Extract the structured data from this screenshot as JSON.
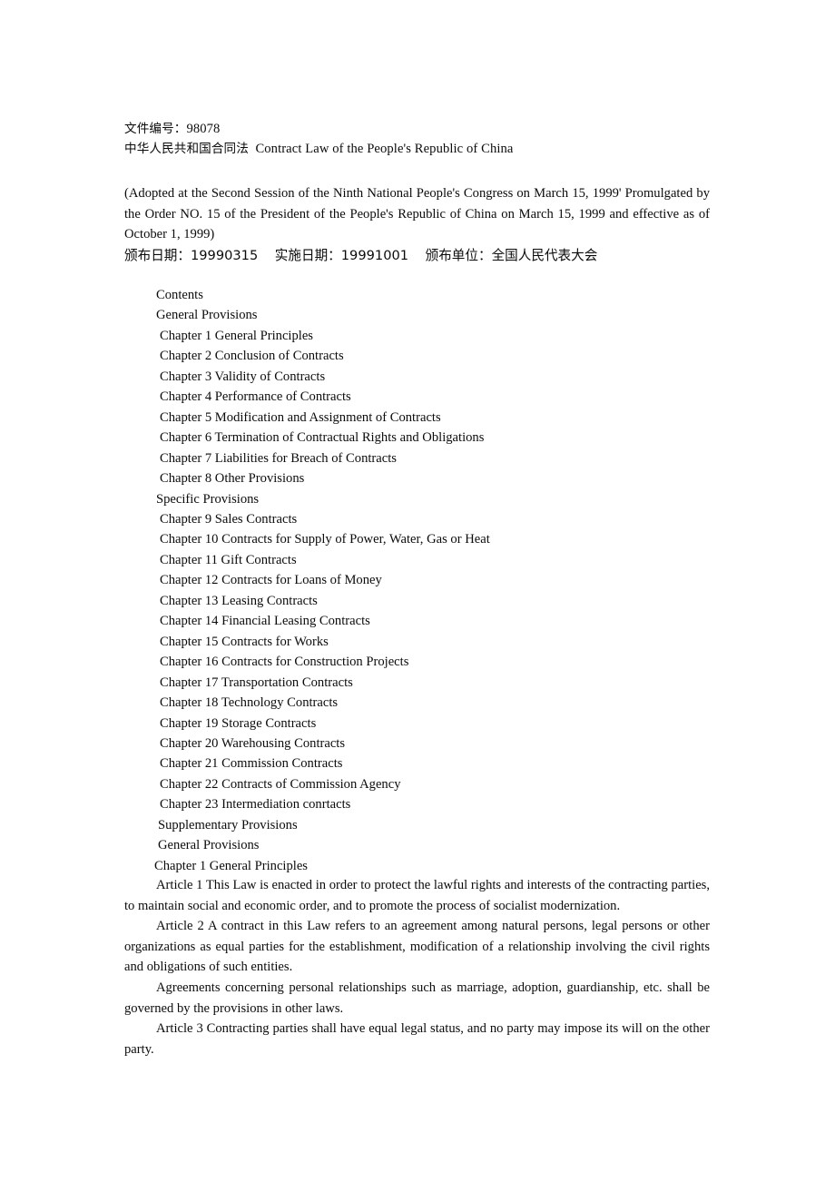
{
  "document": {
    "file_number_label": "文件编号：",
    "file_number_value": "98078",
    "title_cn": "中华人民共和国合同法",
    "title_en": "Contract Law of the People's Republic of China"
  },
  "adoption": {
    "note": "(Adopted at the Second Session of the Ninth National People's Congress on March 15, 1999' Promulgated by the Order NO. 15 of the President of the People's Republic of China on March 15, 1999 and effective as of October 1, 1999)",
    "dates_line": "颁布日期：19990315    实施日期：19991001    颁布单位：全国人民代表大会"
  },
  "contents": {
    "items": [
      {
        "label": "Contents",
        "level": 0
      },
      {
        "label": "General Provisions",
        "level": 0
      },
      {
        "label": "Chapter 1 General Principles",
        "level": 1
      },
      {
        "label": "Chapter 2 Conclusion of Contracts",
        "level": 1
      },
      {
        "label": "Chapter 3 Validity of Contracts",
        "level": 1
      },
      {
        "label": "Chapter 4 Performance of Contracts",
        "level": 1
      },
      {
        "label": "Chapter 5 Modification and Assignment of Contracts",
        "level": 1
      },
      {
        "label": "Chapter 6 Termination of Contractual Rights and Obligations",
        "level": 1
      },
      {
        "label": "Chapter 7 Liabilities for Breach of Contracts",
        "level": 1
      },
      {
        "label": "Chapter 8 Other Provisions",
        "level": 1
      },
      {
        "label": "Specific Provisions",
        "level": 0
      },
      {
        "label": "Chapter 9 Sales Contracts",
        "level": 1
      },
      {
        "label": "Chapter 10 Contracts for Supply of Power, Water, Gas or Heat",
        "level": 1
      },
      {
        "label": "Chapter 11 Gift Contracts",
        "level": 1
      },
      {
        "label": "Chapter 12 Contracts for Loans of Money",
        "level": 1
      },
      {
        "label": "Chapter 13 Leasing Contracts",
        "level": 1
      },
      {
        "label": "Chapter 14 Financial Leasing Contracts",
        "level": 1
      },
      {
        "label": "Chapter 15 Contracts for Works",
        "level": 1
      },
      {
        "label": "Chapter 16 Contracts for Construction Projects",
        "level": 1
      },
      {
        "label": "Chapter 17 Transportation Contracts",
        "level": 1
      },
      {
        "label": "Chapter 18 Technology Contracts",
        "level": 1
      },
      {
        "label": "Chapter 19 Storage Contracts",
        "level": 1
      },
      {
        "label": "Chapter 20 Warehousing Contracts",
        "level": 1
      },
      {
        "label": "Chapter 21 Commission Contracts",
        "level": 1
      },
      {
        "label": "Chapter 22 Contracts of Commission Agency",
        "level": 1
      },
      {
        "label": "Chapter 23 Intermediation conrtacts",
        "level": 1
      },
      {
        "label": "Supplementary Provisions",
        "level": 2
      },
      {
        "label": "General Provisions",
        "level": 2
      },
      {
        "label": "Chapter 1 General Principles",
        "level": 3
      }
    ]
  },
  "articles": [
    {
      "text": "Article 1 This Law is enacted in order to protect the lawful rights and interests of the contracting parties, to maintain social and economic order, and to promote the process of socialist modernization."
    },
    {
      "text": "Article 2 A contract in this Law refers to an agreement among natural persons, legal persons or other organizations as equal parties for the establishment, modification of a relationship involving the civil rights and obligations of such entities."
    },
    {
      "text": "Agreements concerning personal relationships such as marriage, adoption, guardianship, etc. shall be governed by the provisions in other laws."
    },
    {
      "text": "Article 3 Contracting parties shall have equal legal status, and no party may impose its will on the other party."
    }
  ]
}
